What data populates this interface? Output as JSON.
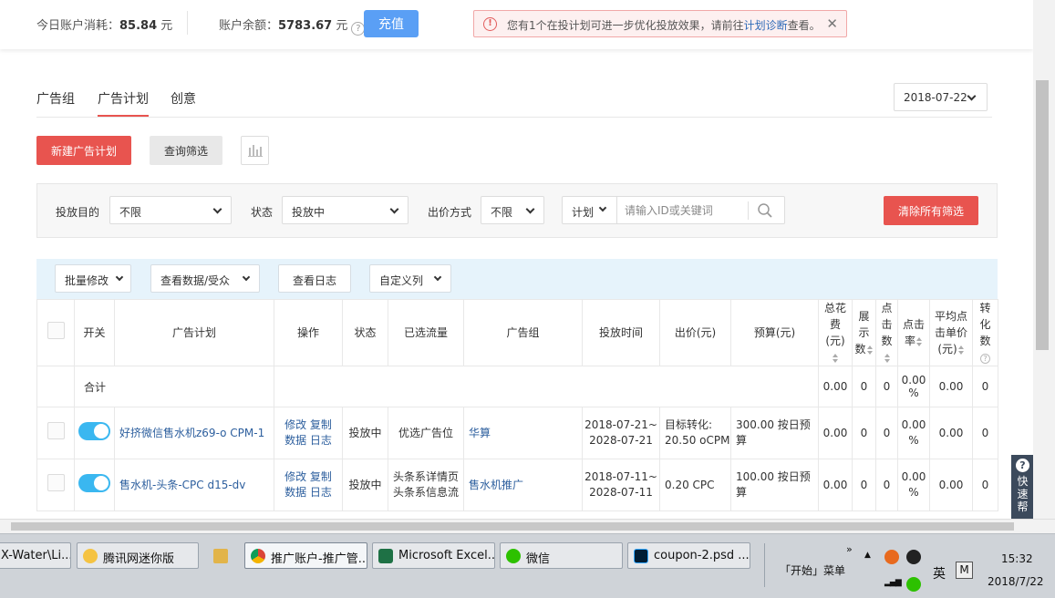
{
  "account": {
    "spend_label": "今日账户消耗：",
    "spend_value": "85.84",
    "spend_unit": "元",
    "balance_label": "账户余额：",
    "balance_value": "5783.67",
    "balance_unit": "元",
    "recharge_label": "充值",
    "help_glyph": "?"
  },
  "alert": {
    "text_before": "您有1个在投计划可进一步优化投放效果，请前往",
    "link": "计划诊断",
    "text_after": "查看。"
  },
  "tabs": [
    {
      "label": "广告组",
      "active": false
    },
    {
      "label": "广告计划",
      "active": true
    },
    {
      "label": "创意",
      "active": false
    }
  ],
  "date": "2018-07-22",
  "actions": {
    "new_plan": "新建广告计划",
    "query": "查询筛选"
  },
  "filters": {
    "purpose_label": "投放目的",
    "purpose_value": "不限",
    "status_label": "状态",
    "status_value": "投放中",
    "bid_label": "出价方式",
    "bid_value": "不限",
    "search_scope": "计划",
    "search_placeholder": "请输入ID或关键词",
    "clear_all": "清除所有筛选"
  },
  "table_toolbar": {
    "batch_edit": "批量修改",
    "view_data": "查看数据/受众",
    "view_log": "查看日志",
    "custom_columns": "自定义列"
  },
  "table": {
    "headers": {
      "switch": "开关",
      "plan": "广告计划",
      "ops": "操作",
      "status": "状态",
      "traffic": "已选流量",
      "group": "广告组",
      "time": "投放时间",
      "bid": "出价(元)",
      "budget": "预算(元)",
      "cost": "总花费(元)",
      "impr": "展示数",
      "click": "点击数",
      "ctr": "点击率",
      "avg_cpc": "平均点击单价(元)",
      "conv": "转化数"
    },
    "summary": {
      "label": "合计",
      "cost": "0.00",
      "impr": "0",
      "click": "0",
      "ctr": "0.00 %",
      "avg_cpc": "0.00",
      "conv": "0"
    },
    "rows": [
      {
        "plan": "好挤微信售水机z69-o CPM-1",
        "op_edit": "修改",
        "op_copy": "复制",
        "op_data": "数据",
        "op_log": "日志",
        "status": "投放中",
        "traffic": "优选广告位",
        "group": "华算",
        "time": "2018-07-21~ 2028-07-21",
        "bid": "目标转化: 20.50 oCPM",
        "budget": "300.00 按日预算",
        "cost": "0.00",
        "impr": "0",
        "click": "0",
        "ctr": "0.00 %",
        "avg_cpc": "0.00",
        "conv": "0"
      },
      {
        "plan": "售水机-头条-CPC d15-dv",
        "op_edit": "修改",
        "op_copy": "复制",
        "op_data": "数据",
        "op_log": "日志",
        "status": "投放中",
        "traffic": "头条系详情页 头条系信息流",
        "group": "售水机推广",
        "time": "2018-07-11~ 2028-07-11",
        "bid": "0.20 CPC",
        "budget": "100.00 按日预算",
        "cost": "0.00",
        "impr": "0",
        "click": "0",
        "ctr": "0.00 %",
        "avg_cpc": "0.00",
        "conv": "0"
      }
    ]
  },
  "help_float": {
    "chars": [
      "快",
      "速",
      "帮"
    ]
  },
  "taskbar": {
    "tasks": [
      {
        "label": "X-Water\\Li..."
      },
      {
        "label": "腾讯网迷你版"
      },
      {
        "label": "推广账户-推广管..."
      },
      {
        "label": "Microsoft Excel..."
      },
      {
        "label": "微信"
      },
      {
        "label": "coupon-2.psd ..."
      }
    ],
    "start_menu": "「开始」菜单",
    "ime": "英",
    "ime_mode": "M",
    "time": "15:32",
    "date": "2018/7/22"
  }
}
